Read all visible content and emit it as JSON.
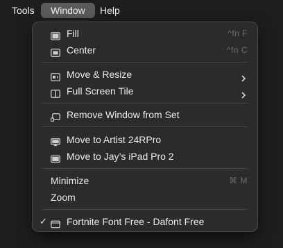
{
  "menubar": {
    "items": [
      {
        "label": "Tools"
      },
      {
        "label": "Window"
      },
      {
        "label": "Help"
      }
    ]
  },
  "menu": {
    "fill": {
      "label": "Fill",
      "shortcut": "^fn F",
      "icon": "window-fill-icon"
    },
    "center": {
      "label": "Center",
      "shortcut": "^fn C",
      "icon": "window-center-icon"
    },
    "move_resize": {
      "label": "Move & Resize",
      "icon": "move-resize-icon"
    },
    "full_screen_tile": {
      "label": "Full Screen Tile",
      "icon": "split-view-icon"
    },
    "remove_window": {
      "label": "Remove Window from Set",
      "icon": "remove-window-icon"
    },
    "move_artist": {
      "label": "Move to Artist 24RPro",
      "icon": "display-icon"
    },
    "move_ipad": {
      "label": "Move to Jay’s iPad Pro 2",
      "icon": "ipad-icon"
    },
    "minimize": {
      "label": "Minimize",
      "shortcut": "⌘ M"
    },
    "zoom": {
      "label": "Zoom"
    },
    "window_item": {
      "label": "Fortnite Font Free - Dafont Free",
      "check": "✓",
      "icon": "window-icon"
    }
  }
}
